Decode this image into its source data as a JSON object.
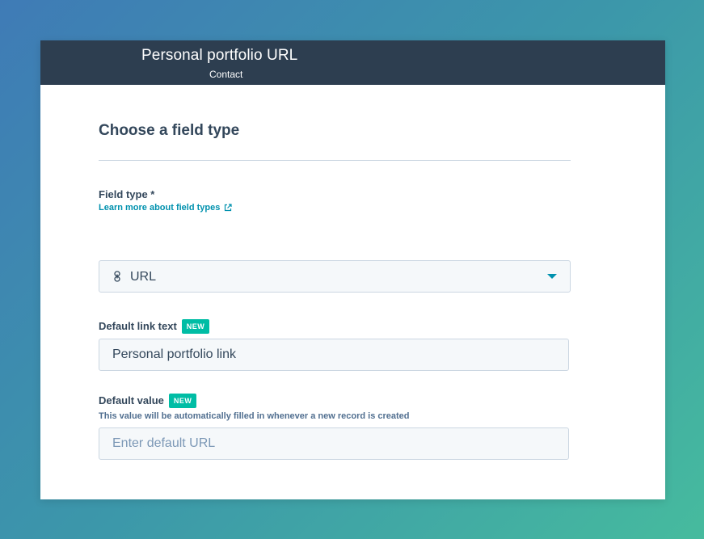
{
  "header": {
    "title": "Personal portfolio URL",
    "subtitle": "Contact"
  },
  "section": {
    "title": "Choose a field type"
  },
  "field_type": {
    "label": "Field type *",
    "help_link": "Learn more about field types",
    "selected_value": "URL",
    "icon": "link-icon"
  },
  "default_link_text": {
    "label": "Default link text",
    "badge": "NEW",
    "value": "Personal portfolio link"
  },
  "default_value": {
    "label": "Default value",
    "badge": "NEW",
    "help_text": "This value will be automatically filled in whenever a new record is created",
    "placeholder": "Enter default URL",
    "value": ""
  },
  "colors": {
    "header_bg": "#2d3e50",
    "accent": "#0091ae",
    "badge": "#00bda5",
    "text": "#33475b"
  }
}
